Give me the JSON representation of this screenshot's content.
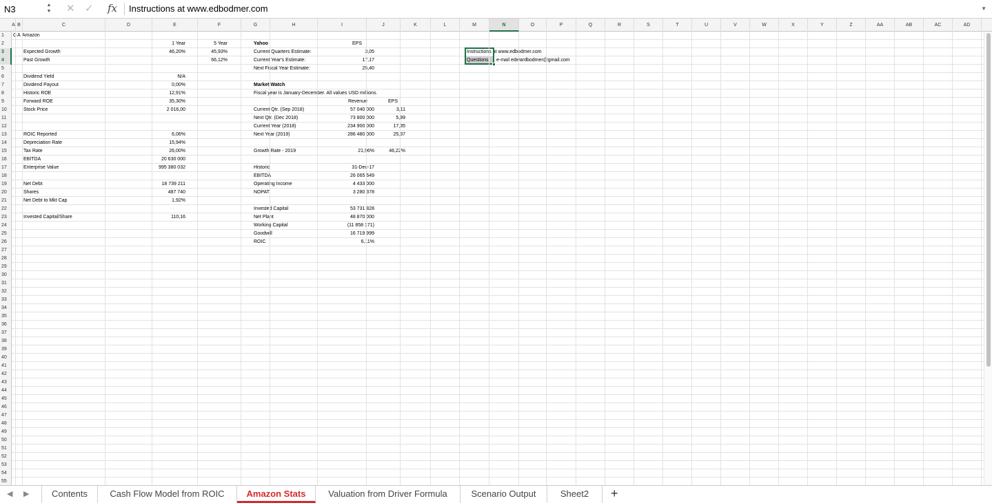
{
  "formula_bar": {
    "name_box": "N3",
    "cancel_icon": "close-icon",
    "confirm_icon": "check-icon",
    "fx_label": "fx",
    "formula": "Instructions at www.edbodmer.com"
  },
  "columns": [
    "A",
    "B",
    "C",
    "D",
    "E",
    "F",
    "G",
    "H",
    "I",
    "J",
    "K",
    "L",
    "M",
    "N",
    "O",
    "P",
    "Q",
    "R",
    "S",
    "T",
    "U",
    "V",
    "W",
    "X",
    "Y",
    "Z",
    "AA",
    "AB",
    "AC",
    "AD",
    "AE"
  ],
  "selected": {
    "column": "N",
    "rows": [
      "3",
      "4"
    ]
  },
  "rows": [
    "1",
    "2",
    "3",
    "4",
    "5",
    "6",
    "7",
    "8",
    "9",
    "10",
    "11",
    "12",
    "13",
    "14",
    "15",
    "16",
    "17",
    "18",
    "19",
    "20",
    "21",
    "22",
    "23",
    "24",
    "25",
    "26",
    "27",
    "28",
    "29",
    "30",
    "31",
    "32",
    "33",
    "34",
    "35",
    "36",
    "37",
    "38",
    "39",
    "40",
    "41",
    "42",
    "43",
    "44",
    "45",
    "46",
    "47",
    "48",
    "49",
    "50",
    "51",
    "52",
    "53",
    "54",
    "55"
  ],
  "cells": {
    "c1a": "C",
    "c1b": "A",
    "c1c": "Amazon",
    "e2": "1 Year",
    "f2": "5 Year",
    "e3": "46,20%",
    "f3": "45,93%",
    "f4": "66,12%",
    "c3": "Expected Growth",
    "c4": "Past Growth",
    "h2": "Yahoo",
    "j2": "EPS",
    "h3": "Current Quarters Estimate:",
    "j3": "3,05",
    "h4": "Current Year's Estimate:",
    "j4": "17,17",
    "h5": "Next Fiscal Year Estimate:",
    "j5": "25,40",
    "c6": "Dividend Yield",
    "e6": "N/A",
    "c7": "Dividend Payout",
    "e7": "0,00%",
    "c8": "Historic ROE",
    "e8": "12,91%",
    "c9": "Forward ROE",
    "e9": "35,30%",
    "c10": "Stock Price",
    "e10": "2 016,00",
    "h8": "Market Watch",
    "h9": "Fiscal year is January-December. All values USD millions.",
    "j10h": "Revenue",
    "k10h": "EPS",
    "h11": "Current Qtr. (Sep 2018)",
    "j11": "57 040 000",
    "k11": "3,11",
    "h12": "Next Qtr. (Dec 2018)",
    "j12": "73 800 000",
    "k12": "5,99",
    "h13": "Current Year (2018)",
    "j13": "234 900 000",
    "k13": "17,35",
    "h14": "Next Year (2019)",
    "j14": "286 480 000",
    "k14": "25,37",
    "c13": "ROIC Reported",
    "e13": "6,06%",
    "c14": "Depreciation Rate",
    "e14": "15,94%",
    "c15": "Tax Rate",
    "e15": "26,00%",
    "c16": "EBITDA",
    "e16": "20 630 000",
    "c17": "Enterprise Value",
    "e17": "995 380 032",
    "h15": "Growth Rate - 2019",
    "j15": "21,96%",
    "k15": "46,22%",
    "h17": "Historic",
    "j17": "31-Dec-17",
    "h18": "EBITDA",
    "j18": "26 065 649",
    "h19": "Operating Income",
    "j19": "4 433 000",
    "h20": "NOPAT",
    "j20": "3 280 378",
    "c19": "Net Debt",
    "e19": "18 739 211",
    "c20": "Shares",
    "e20": "487 740",
    "c21": "Net Debt to Mkt Cap",
    "e21": "1,92%",
    "c23": "Invested Capital/Share",
    "e23": "110,16",
    "h22": "Invested Capital",
    "j22": "53 731 828",
    "h23": "Net Plant",
    "j23": "48 870 000",
    "h24": "Working Capital",
    "j24": "(11 858 171)",
    "h25": "Goodwill",
    "j25": "16 719 999",
    "h26": "ROIC",
    "j26": "6,11%",
    "n3": "Instructions at www.edbodmer.com",
    "n4a": "Questions",
    "n4b": "e-mail edwardbodmer@gmail.com"
  },
  "tabs": [
    "Contents",
    "Cash Flow Model from ROIC",
    "Amazon Stats",
    "Valuation from Driver Formula",
    "Scenario Output",
    "Sheet2"
  ],
  "active_tab": "Amazon Stats",
  "add_sheet": "+",
  "colors": {
    "accent": "#1e7145",
    "active_tab": "#d42b2b"
  }
}
